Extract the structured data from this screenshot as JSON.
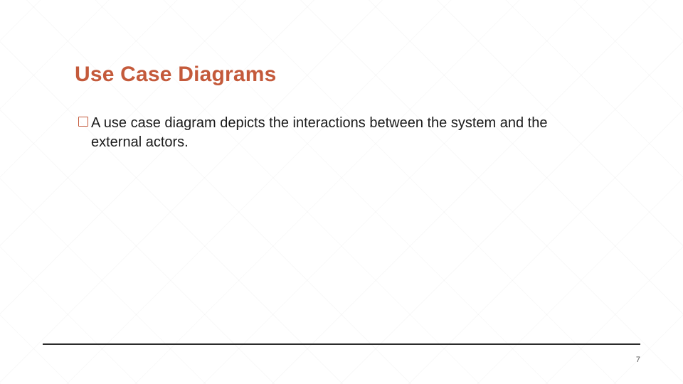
{
  "slide": {
    "title": "Use Case Diagrams",
    "bullets": [
      {
        "text": "A use case diagram depicts the interactions between the system and the external actors."
      }
    ],
    "page_number": "7"
  },
  "colors": {
    "accent": "#c45a3b",
    "rule": "#2b2b2b",
    "text": "#1a1a1a"
  }
}
